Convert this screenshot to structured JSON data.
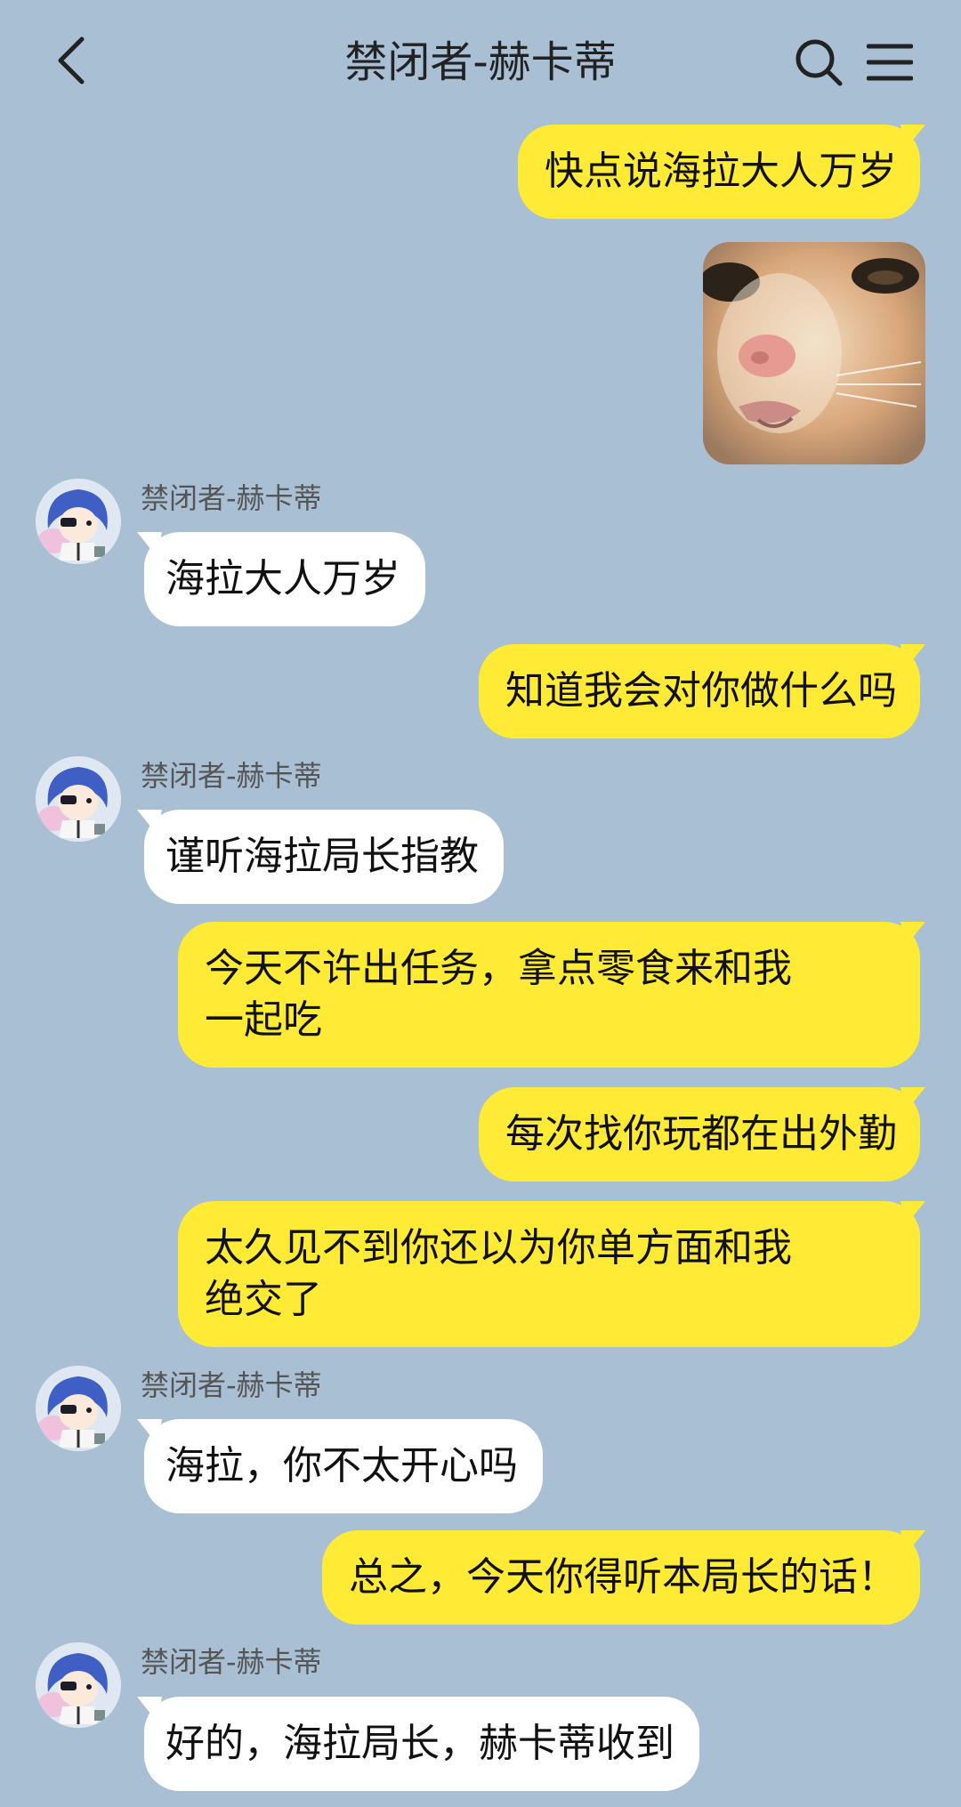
{
  "header": {
    "title": "禁闭者-赫卡蒂"
  },
  "messages": [
    {
      "dir": "out",
      "text": "快点说海拉大人万岁"
    },
    {
      "dir": "out",
      "type": "image",
      "icon": "cat-meme-image"
    },
    {
      "dir": "in",
      "sender": "禁闭者-赫卡蒂",
      "text": "海拉大人万岁"
    },
    {
      "dir": "out",
      "text": "知道我会对你做什么吗"
    },
    {
      "dir": "in",
      "sender": "禁闭者-赫卡蒂",
      "text": "谨听海拉局长指教"
    },
    {
      "dir": "out",
      "line1": "今天不许出任务，拿点零食来和我",
      "line2": "一起吃"
    },
    {
      "dir": "out",
      "text": "每次找你玩都在出外勤"
    },
    {
      "dir": "out",
      "line1": "太久见不到你还以为你单方面和我",
      "line2": "绝交了"
    },
    {
      "dir": "in",
      "sender": "禁闭者-赫卡蒂",
      "text": "海拉，你不太开心吗"
    },
    {
      "dir": "out",
      "text": "总之，今天你得听本局长的话！"
    },
    {
      "dir": "in",
      "sender": "禁闭者-赫卡蒂",
      "text": "好的，海拉局长，赫卡蒂收到"
    }
  ],
  "colors": {
    "background": "#a8bfd4",
    "outgoing_bubble": "#ffea35",
    "incoming_bubble": "#ffffff"
  },
  "icons": [
    "back-arrow-icon",
    "search-icon",
    "menu-icon"
  ]
}
